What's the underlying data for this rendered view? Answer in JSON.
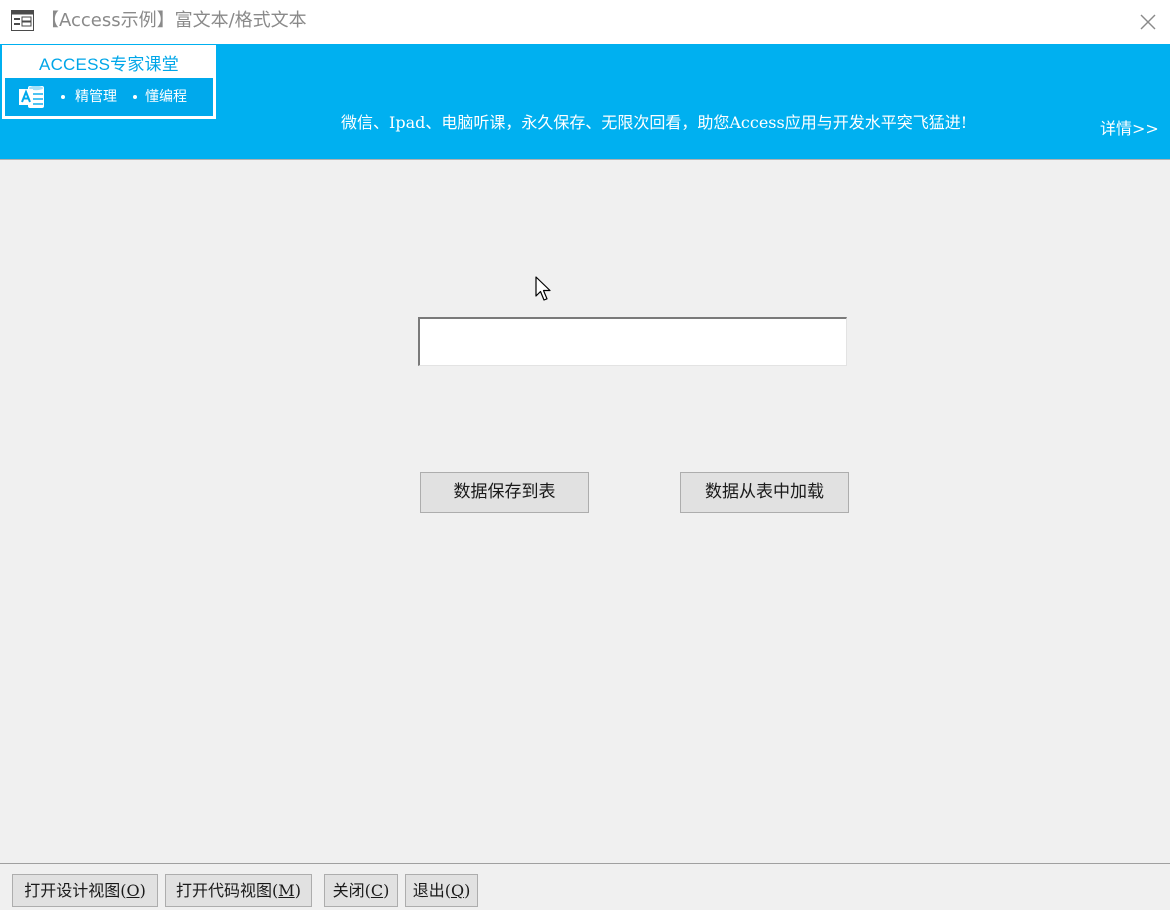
{
  "window": {
    "title": "【Access示例】富文本/格式文本",
    "icon": "form-icon",
    "close_icon": "close-icon"
  },
  "banner": {
    "logo": {
      "title": "ACCESS专家课堂",
      "tag1": "精管理",
      "tag2": "懂编程",
      "icon": "access-logo-icon"
    },
    "promo_text": "微信、Ipad、电脑听课，永久保存、无限次回看，助您Access应用与开发水平突飞猛进!",
    "details_link": "详情>>",
    "colors": {
      "background": "#00b0f0",
      "logo_text": "#00a6e8"
    }
  },
  "main": {
    "rich_text_input": {
      "value": ""
    },
    "save_button": "数据保存到表",
    "load_button": "数据从表中加载"
  },
  "footer": {
    "design_view_button": {
      "label": "打开设计视图(",
      "accel": "O",
      "end": ")"
    },
    "code_view_button": {
      "label": "打开代码视图(",
      "accel": "M",
      "end": ")"
    },
    "close_button": {
      "label": "关闭(",
      "accel": "C",
      "end": ")"
    },
    "exit_button": {
      "label": "退出(",
      "accel": "Q",
      "end": ")"
    }
  }
}
